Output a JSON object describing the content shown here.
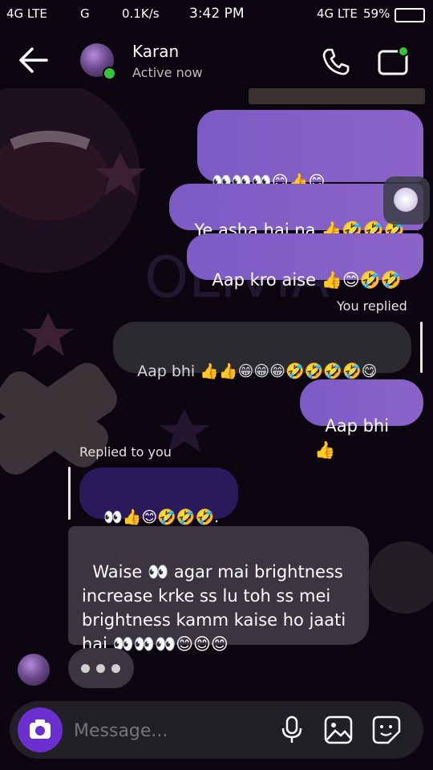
{
  "status_bar": {
    "network_left": "4G LTE",
    "network_g": "G",
    "speed": "0.1K/s",
    "time": "3:42 PM",
    "network_right": "4G LTE",
    "battery": "59%"
  },
  "header": {
    "contact_name": "Karan",
    "status": "Active now"
  },
  "messages": {
    "m1_line1": "👀👀👀😊👍😊",
    "m1_line2": "🤣🤣🤣🤣🤣🤣🤣🤣.",
    "m2": "Ye asha hai na 👍🤣🤣🤣",
    "m3": "Aap kro aise 👍😊🤣🤣",
    "you_replied_label": "You replied",
    "quoted_reply": "Aap bhi 👍👍😁😁😁🤣🤣🤣🤣😋",
    "m4": "Aap bhi 👍",
    "replied_to_you_label": "Replied to you",
    "quoted_incoming": "👀👍😊🤣🤣🤣.",
    "incoming_long": "Waise 👀 agar mai brightness\nincrease krke ss lu toh ss mei\nbrightness kamm kaise ho jaati\nhai 👀👀👀😊😊😊"
  },
  "composer": {
    "placeholder": "Message..."
  },
  "icons": {
    "back": "arrow-left-icon",
    "call": "phone-icon",
    "video": "video-camera-icon",
    "camera": "camera-icon",
    "mic": "microphone-icon",
    "gallery": "image-icon",
    "sticker": "sticker-icon"
  },
  "colors": {
    "outgoing_bubble": "#7b5bc4",
    "incoming_bubble": "#3a3540",
    "online": "#37c23c",
    "camera_button": "#6b2fd0"
  }
}
